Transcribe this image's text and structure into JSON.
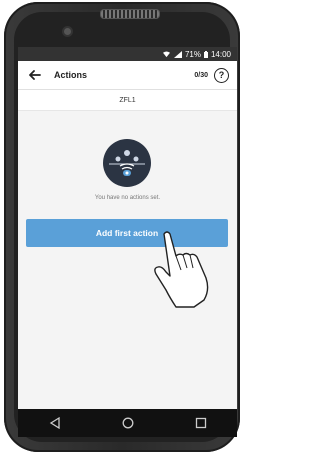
{
  "status_bar": {
    "battery": "71%",
    "time": "14:00"
  },
  "app_bar": {
    "title": "Actions",
    "counter": "0/30",
    "help_label": "?"
  },
  "device_name": "ZFL1",
  "empty_state": {
    "message": "You have no actions set."
  },
  "primary_action": {
    "label": "Add first action"
  },
  "colors": {
    "accent": "#5aa0d8",
    "status_bar": "#333333",
    "emblem": "#2b3443"
  },
  "icons": {
    "back": "arrow-left-icon",
    "help": "question-circle-icon",
    "wifi": "wifi-icon",
    "signal": "signal-icon",
    "battery": "battery-icon",
    "emblem": "device-emblem-icon",
    "nav_back": "triangle-back-icon",
    "nav_home": "circle-home-icon",
    "nav_recent": "square-recent-icon",
    "pointer": "pointing-hand-icon"
  }
}
